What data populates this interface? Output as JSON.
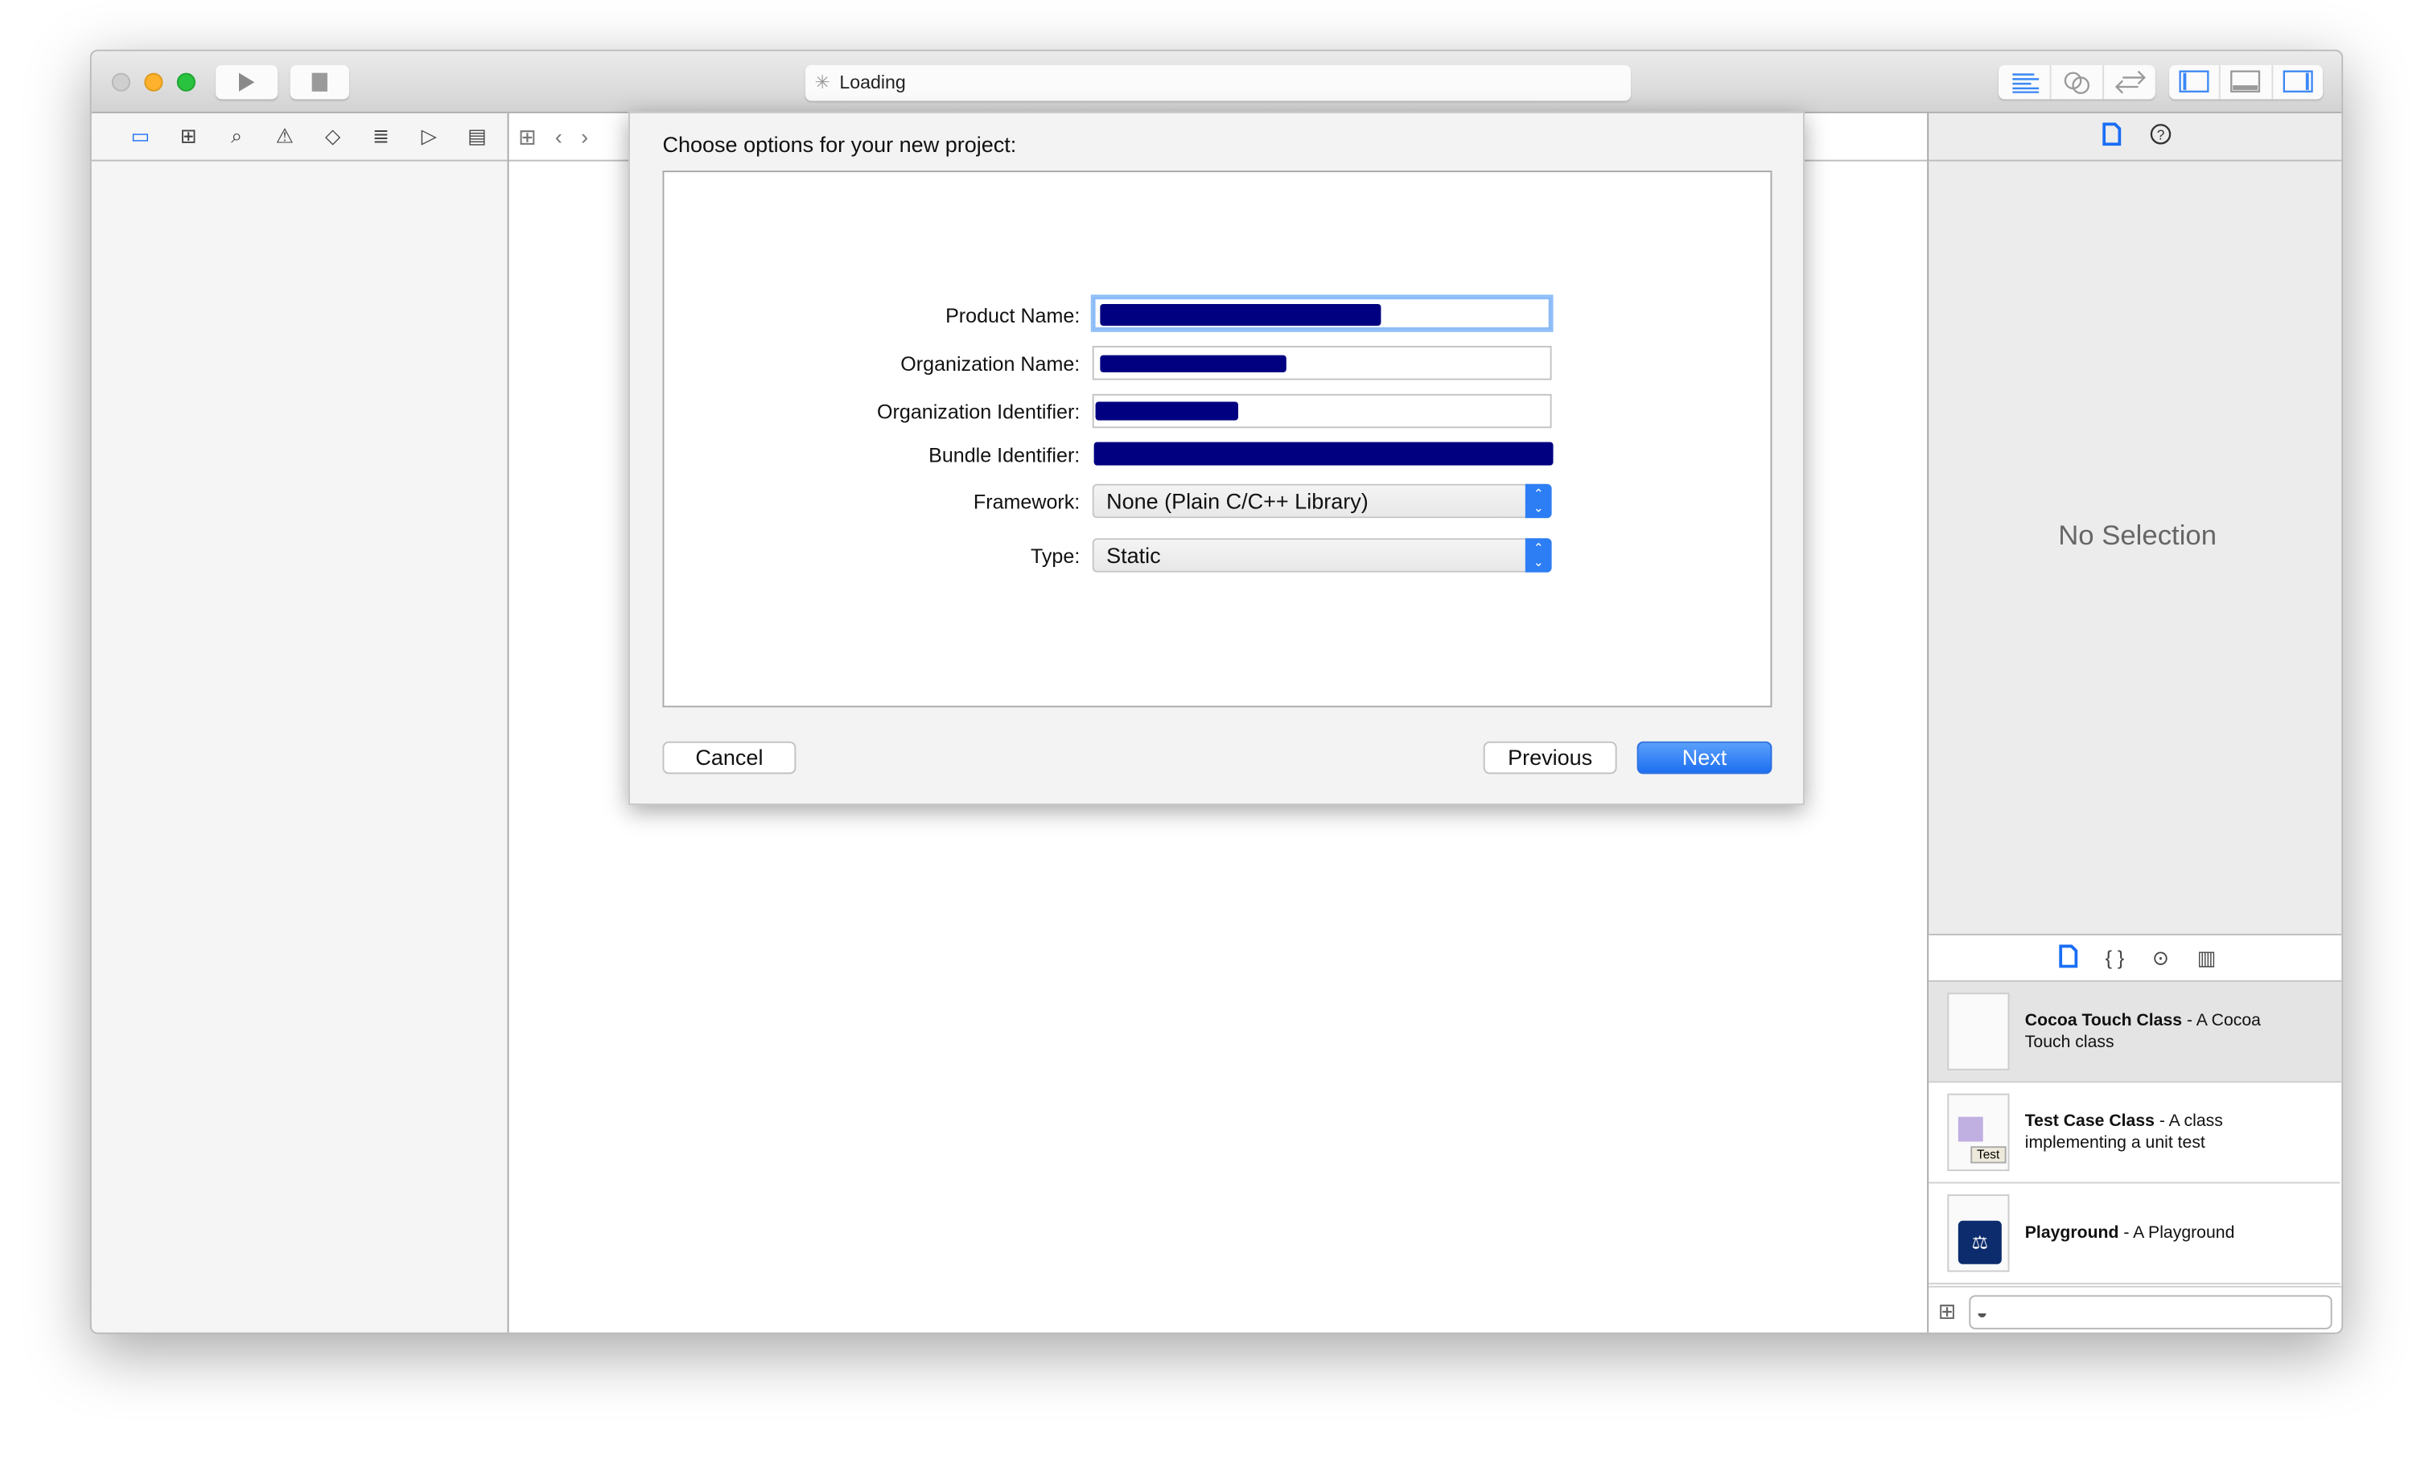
{
  "toolbar": {
    "activity_text": "Loading",
    "run_icon": "play-icon",
    "stop_icon": "stop-icon",
    "editor_modes": [
      "standard-editor-icon",
      "assistant-editor-icon",
      "version-editor-icon"
    ],
    "view_toggles": [
      "navigator-toggle-icon",
      "debug-area-toggle-icon",
      "utilities-toggle-icon"
    ]
  },
  "navigator": {
    "tabs": [
      "folder-icon",
      "hierarchy-icon",
      "search-icon",
      "warning-icon",
      "test-icon",
      "debug-icon",
      "breakpoint-icon",
      "report-icon"
    ]
  },
  "dialog": {
    "title": "Choose options for your new project:",
    "fields": [
      {
        "label": "Product Name:"
      },
      {
        "label": "Organization Name:"
      },
      {
        "label": "Organization Identifier:"
      },
      {
        "label": "Bundle Identifier:"
      }
    ],
    "framework": {
      "label": "Framework:",
      "value": "None (Plain C/C++ Library)"
    },
    "type": {
      "label": "Type:",
      "value": "Static"
    },
    "cancel": "Cancel",
    "previous": "Previous",
    "next": "Next"
  },
  "inspector": {
    "empty_text": "No Selection"
  },
  "library": {
    "items": [
      {
        "name": "Cocoa Touch Class",
        "desc": " - A Cocoa Touch class"
      },
      {
        "name": "Test Case Class",
        "desc": " - A class implementing a unit test",
        "badge": "Test"
      },
      {
        "name": "Playground",
        "desc": " - A Playground"
      }
    ]
  },
  "colors": {
    "accent": "#2d7ef5",
    "redaction": "#000080"
  }
}
